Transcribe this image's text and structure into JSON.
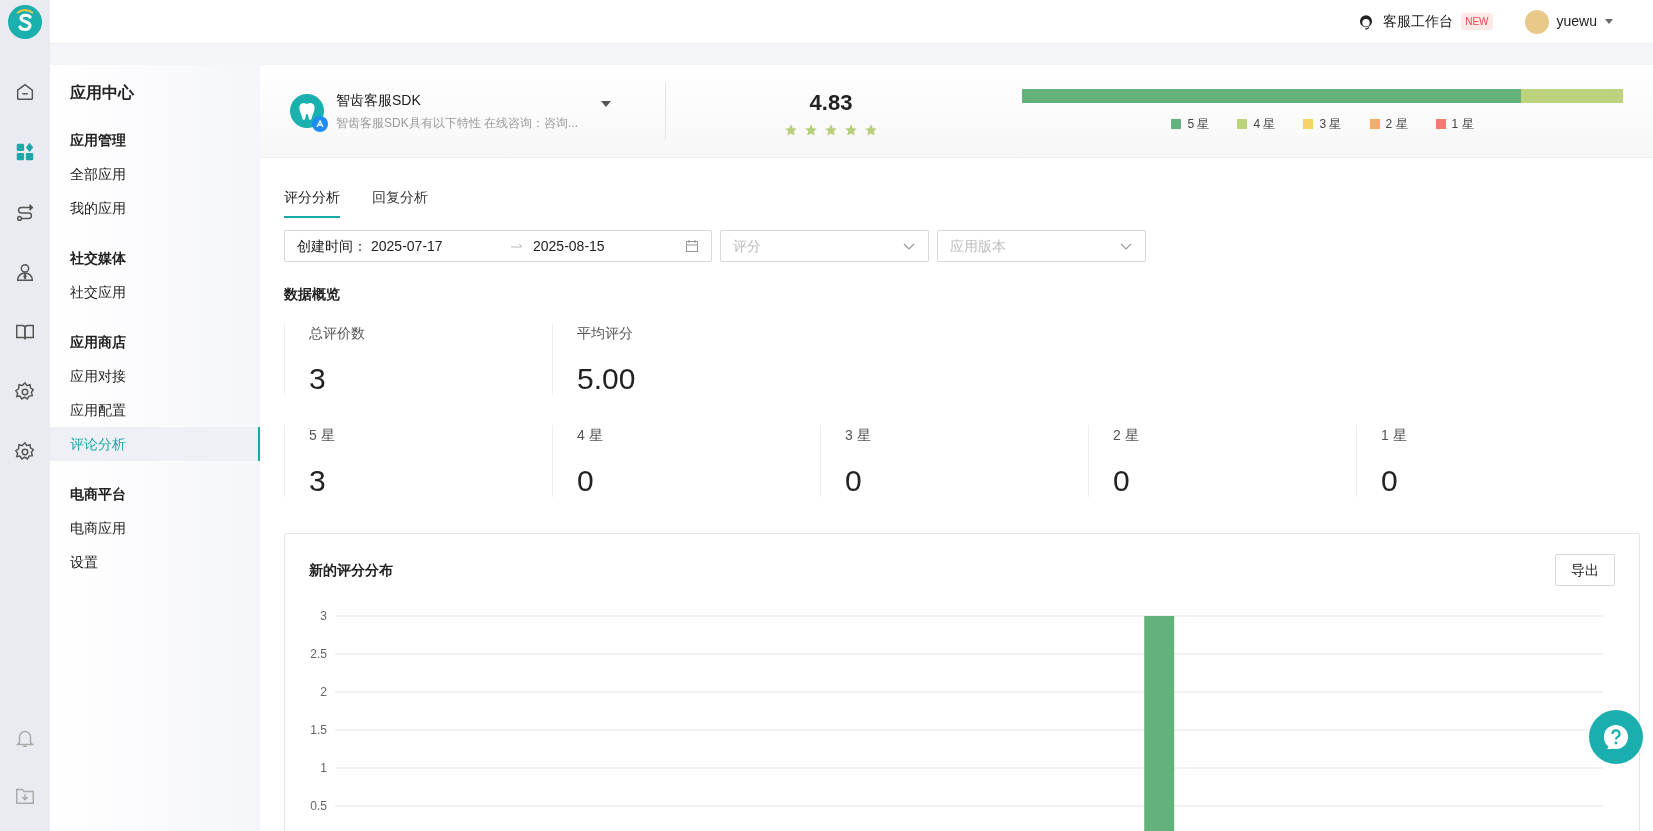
{
  "topbar": {
    "workspace": "客服工作台",
    "badge": "NEW",
    "user": "yuewu"
  },
  "rail": [
    {
      "kind": "home",
      "selected": false
    },
    {
      "kind": "apps",
      "selected": true
    },
    {
      "kind": "route",
      "selected": false
    },
    {
      "kind": "agent",
      "selected": false
    },
    {
      "kind": "book",
      "selected": false
    },
    {
      "kind": "gear",
      "selected": false
    },
    {
      "kind": "gear",
      "selected": false
    }
  ],
  "sidebar": {
    "title": "应用中心",
    "groups": [
      {
        "title": "应用管理",
        "items": [
          {
            "label": "全部应用",
            "selected": false
          },
          {
            "label": "我的应用",
            "selected": false
          }
        ]
      },
      {
        "title": "社交媒体",
        "items": [
          {
            "label": "社交应用",
            "selected": false
          }
        ]
      },
      {
        "title": "应用商店",
        "items": [
          {
            "label": "应用对接",
            "selected": false
          },
          {
            "label": "应用配置",
            "selected": false
          },
          {
            "label": "评论分析",
            "selected": true
          }
        ]
      },
      {
        "title": "电商平台",
        "items": [
          {
            "label": "电商应用",
            "selected": false
          },
          {
            "label": "设置",
            "selected": false
          }
        ]
      }
    ]
  },
  "app": {
    "name": "智齿客服SDK",
    "description": "智齿客服SDK具有以下特性 在线咨询：咨询..."
  },
  "rating": {
    "score": "4.83",
    "stars": 5
  },
  "distribution": [
    {
      "label": "5 星",
      "color": "#64b27b",
      "level": 0.83
    },
    {
      "label": "4 星",
      "color": "#bcd27d",
      "level": 0.17
    },
    {
      "label": "3 星",
      "color": "#f6d365"
    },
    {
      "label": "2 星",
      "color": "#f5ad6a"
    },
    {
      "label": "1 星",
      "color": "#f07a74"
    }
  ],
  "tabs": [
    {
      "label": "评分分析",
      "selected": true
    },
    {
      "label": "回复分析",
      "selected": false
    }
  ],
  "filters": {
    "date_label": "创建时间：",
    "start": "2025-07-17",
    "end": "2025-08-15",
    "rating_placeholder": "评分",
    "version_placeholder": "应用版本"
  },
  "overview": {
    "title": "数据概览",
    "summary": [
      {
        "label": "总评价数",
        "value": "3"
      },
      {
        "label": "平均评分",
        "value": "5.00"
      }
    ],
    "by_star": [
      {
        "label": "5 星",
        "value": "3"
      },
      {
        "label": "4 星",
        "value": "0"
      },
      {
        "label": "3 星",
        "value": "0"
      },
      {
        "label": "2 星",
        "value": "0"
      },
      {
        "label": "1 星",
        "value": "0"
      }
    ]
  },
  "chart_panel": {
    "title": "新的评分分布",
    "export": "导出",
    "chart_data": {
      "type": "bar",
      "grid": true,
      "ylim": [
        0,
        3
      ],
      "yticks": [
        0.5,
        1,
        1.5,
        2,
        2.5,
        3
      ],
      "series": [
        {
          "color": "#64b27b",
          "values": [
            0,
            0,
            0,
            0,
            0,
            0,
            0,
            0,
            0,
            0,
            0,
            0,
            0,
            0,
            0,
            0,
            0,
            0,
            0,
            3,
            0,
            0,
            0,
            0,
            0,
            0,
            0,
            0,
            0,
            0
          ]
        }
      ]
    }
  }
}
